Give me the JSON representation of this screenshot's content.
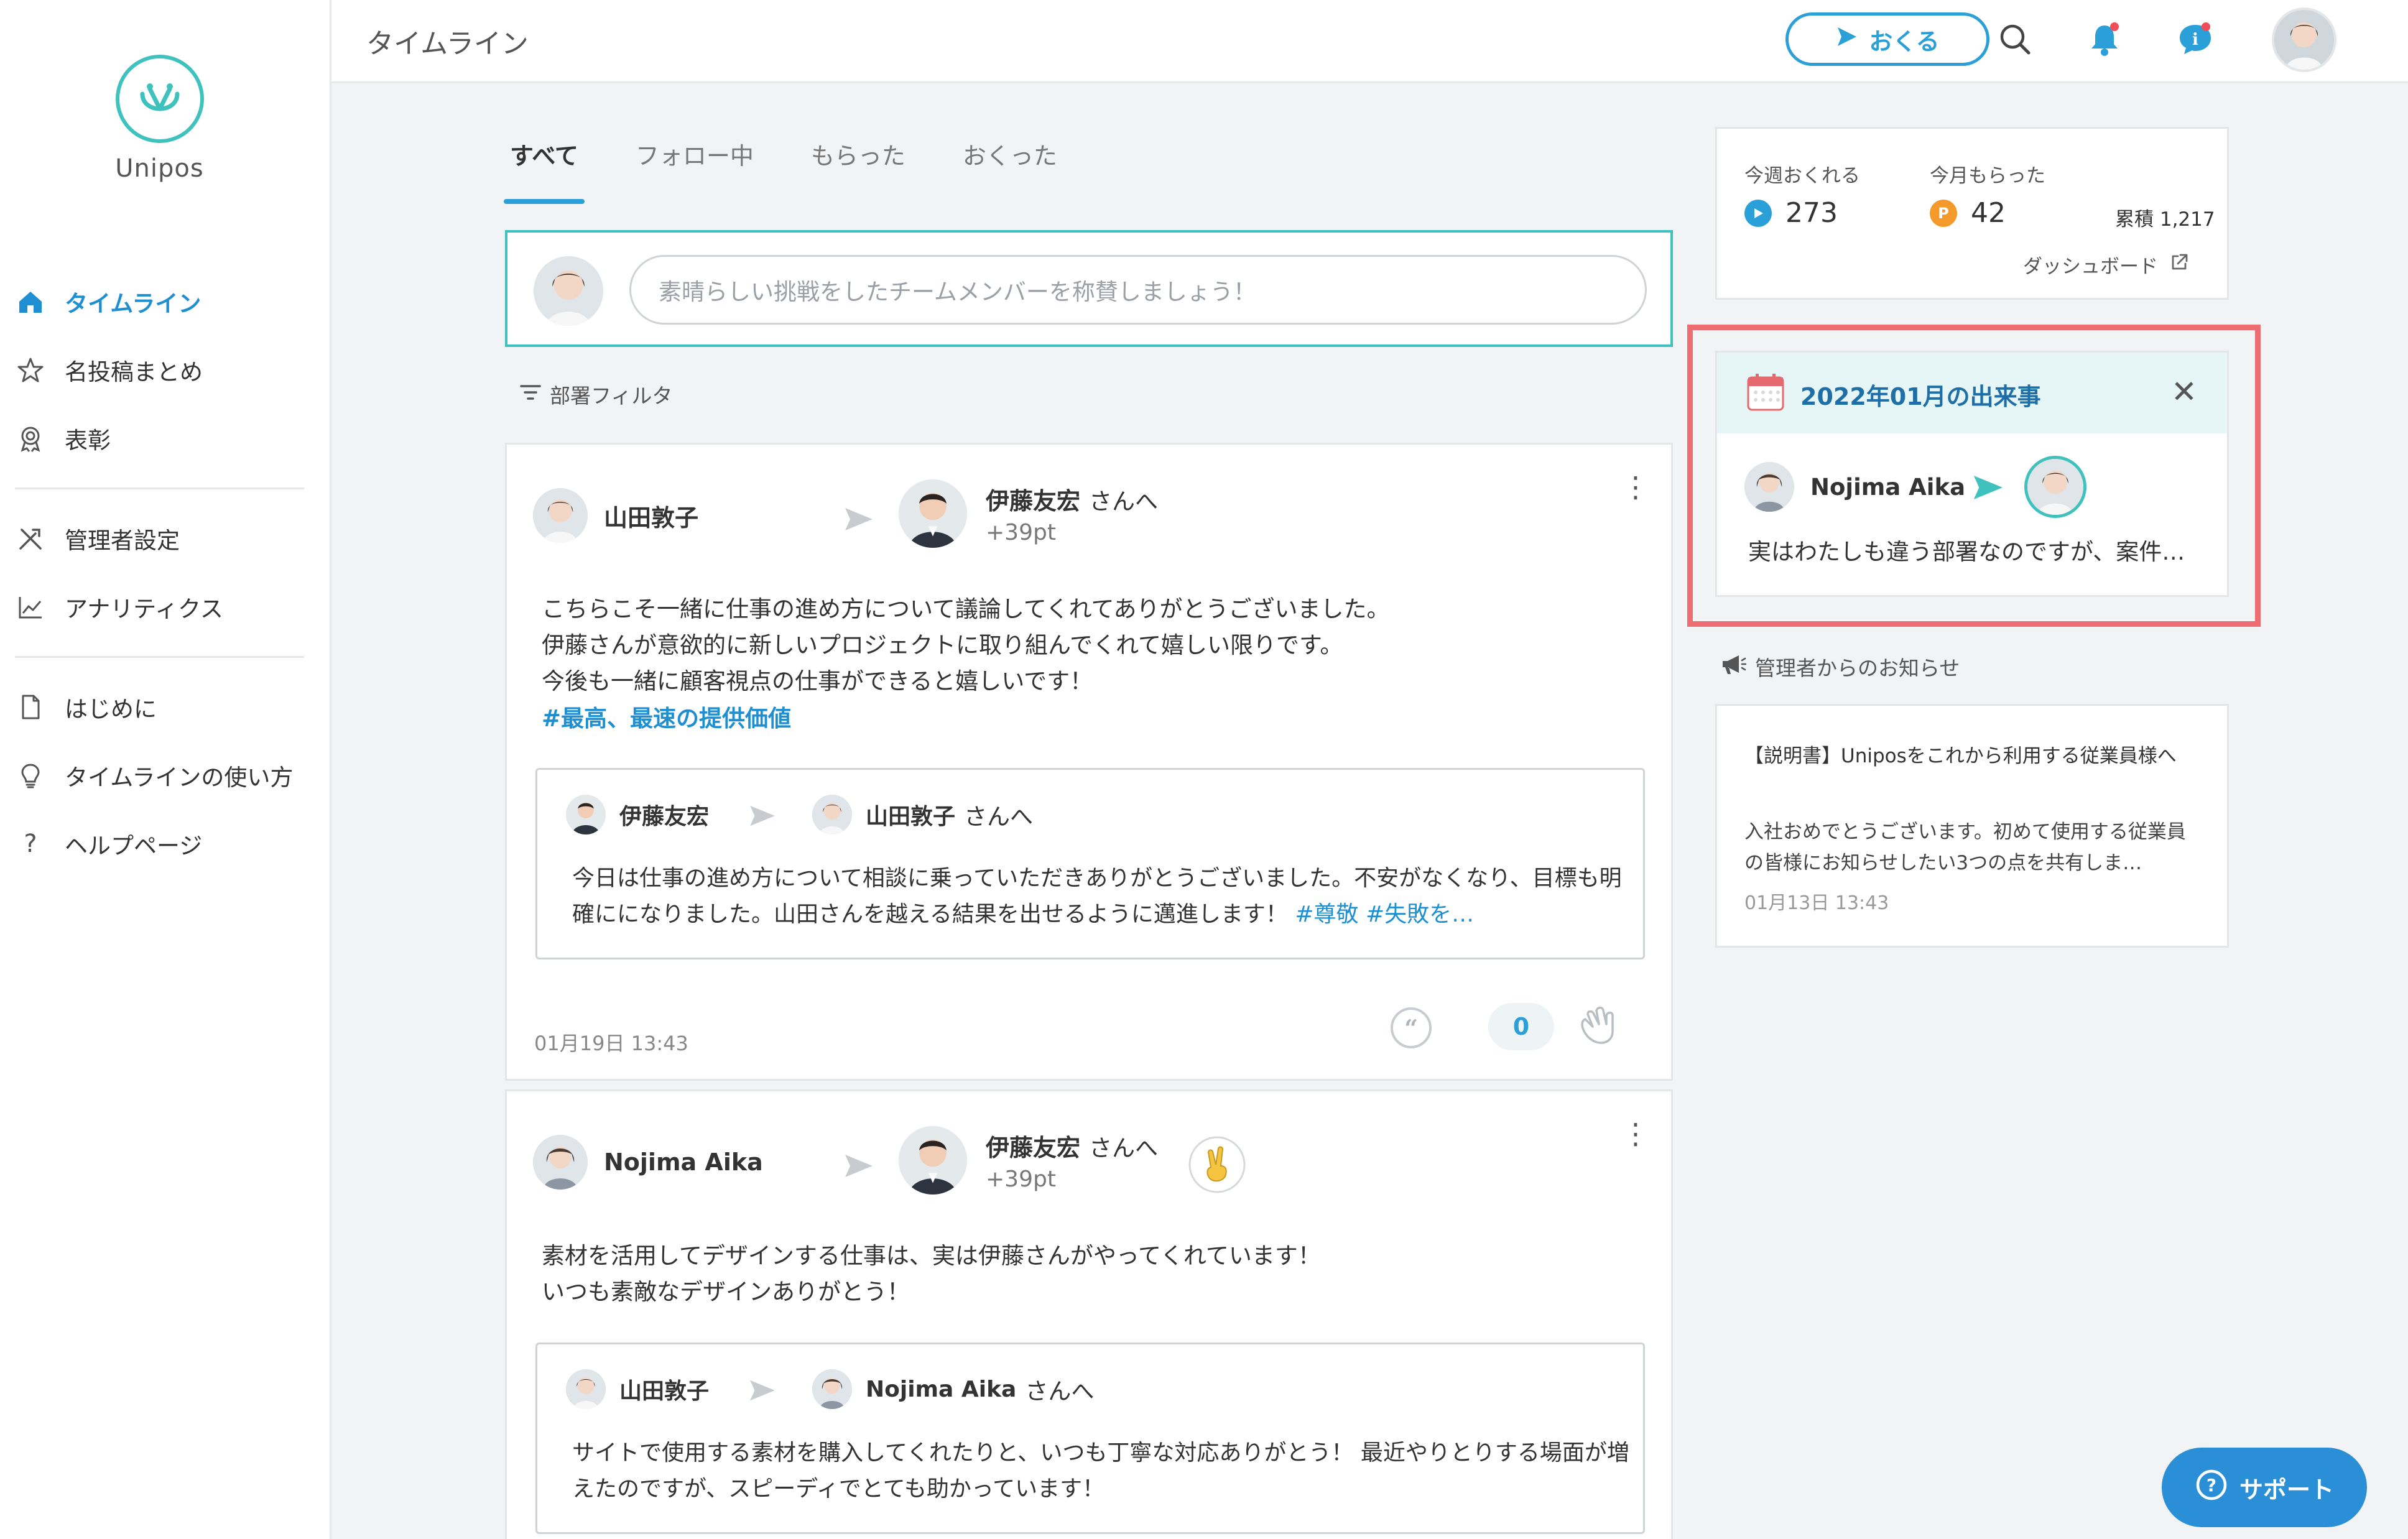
{
  "app": {
    "logo_text": "Unipos"
  },
  "sidebar": {
    "items": [
      {
        "label": "タイムライン",
        "icon": "home-icon"
      },
      {
        "label": "名投稿まとめ",
        "icon": "star-icon"
      },
      {
        "label": "表彰",
        "icon": "award-icon"
      },
      {
        "label": "管理者設定",
        "icon": "tools-icon"
      },
      {
        "label": "アナリティクス",
        "icon": "chart-icon"
      },
      {
        "label": "はじめに",
        "icon": "document-icon"
      },
      {
        "label": "タイムラインの使い方",
        "icon": "lightbulb-icon"
      },
      {
        "label": "ヘルプページ",
        "icon": "question-icon"
      }
    ]
  },
  "header": {
    "title": "タイムライン",
    "send_label": "おくる"
  },
  "tabs": [
    "すべて",
    "フォロー中",
    "もらった",
    "おくった"
  ],
  "compose": {
    "placeholder": "素晴らしい挑戦をしたチームメンバーを称賛しましょう！"
  },
  "filter_label": "部署フィルタ",
  "posts": [
    {
      "sender": "山田敦子",
      "recipient": "伊藤友宏",
      "recipient_suffix": "さんへ",
      "points": "+39pt",
      "message": "こちらこそ一緒に仕事の進め方について議論してくれてありがとうございました。\n伊藤さんが意欲的に新しいプロジェクトに取り組んでくれて嬉しい限りです。\n今後も一緒に顧客視点の仕事ができると嬉しいです！",
      "hashtag": "#最高、最速の提供価値",
      "quoted": {
        "sender": "伊藤友宏",
        "recipient": "山田敦子",
        "recipient_suffix": "さんへ",
        "text": "今日は仕事の進め方について相談に乗っていただきありがとうございました。不安がなくなり、目標も明確にになりました。山田さんを越える結果を出せるように邁進します！",
        "hashtags": "#尊敬 #失敗を…"
      },
      "date": "01月19日 13:43",
      "clap_count": "0"
    },
    {
      "sender": "Nojima Aika",
      "recipient": "伊藤友宏",
      "recipient_suffix": "さんへ",
      "points": "+39pt",
      "message": "素材を活用してデザインする仕事は、実は伊藤さんがやってくれています！\nいつも素敵なデザインありがとう！",
      "quoted": {
        "sender": "山田敦子",
        "recipient": "Nojima Aika",
        "recipient_suffix": "さんへ",
        "text": "サイトで使用する素材を購入してくれたりと、いつも丁寧な対応ありがとう！ 最近やりとりする場面が増えたのですが、スピーディでとても助かっています！"
      }
    }
  ],
  "stats": {
    "weekly_send_label": "今週おくれる",
    "weekly_send_value": "273",
    "monthly_recv_label": "今月もらった",
    "monthly_recv_value": "42",
    "total_label": "累積 1,217",
    "dashboard_label": "ダッシュボード"
  },
  "event": {
    "title": "2022年01月の出来事",
    "sender": "Nojima Aika",
    "text": "実はわたしも違う部署なのですが、案件…"
  },
  "notice": {
    "section_label": "管理者からのお知らせ",
    "title": "【説明書】Uniposをこれから利用する従業員様へ",
    "body": "入社おめでとうございます。初めて使用する従業員の皆様にお知らせしたい3つの点を共有しま…",
    "date": "01月13日 13:43"
  },
  "support_label": "サポート",
  "colors": {
    "accent": "#2a9fd8",
    "teal": "#3fc1be",
    "highlight": "#ee6d73",
    "orange": "#f39a2b"
  }
}
